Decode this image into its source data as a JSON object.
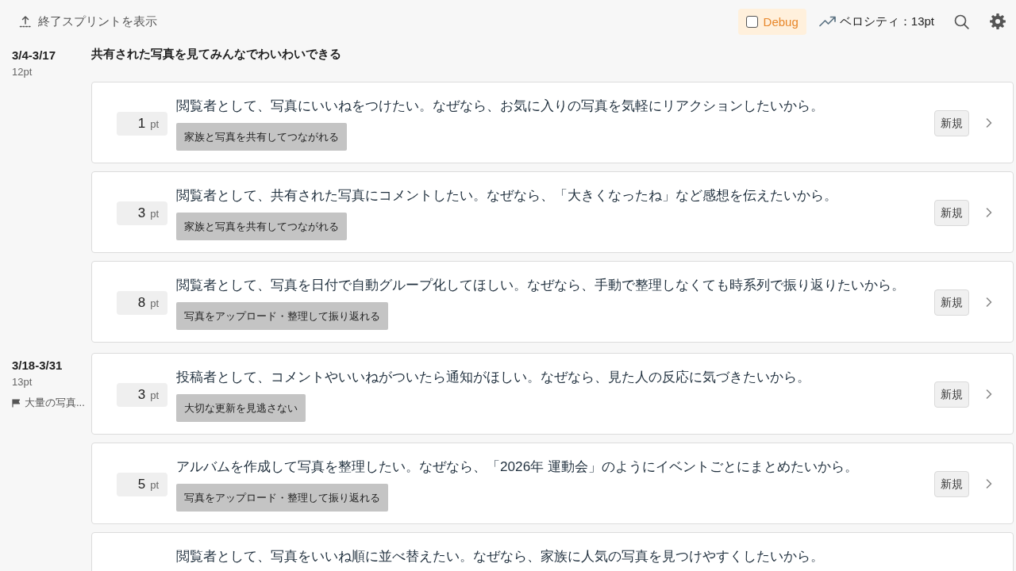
{
  "toolbar": {
    "show_finished": "終了スプリントを表示",
    "debug": {
      "label": "Debug",
      "checked": false
    },
    "velocity": "ベロシティ：13pt"
  },
  "sprints": [
    {
      "dates": "3/4-3/17",
      "points": "12pt",
      "goal": "共有された写真を見てみんなでわいわいできる",
      "stories": [
        {
          "points": "1",
          "unit": "pt",
          "title": "閲覧者として、写真にいいねをつけたい。なぜなら、お気に入りの写真を気軽にリアクションしたいから。",
          "tag": "家族と写真を共有してつながれる",
          "status": "新規"
        },
        {
          "points": "3",
          "unit": "pt",
          "title": "閲覧者として、共有された写真にコメントしたい。なぜなら、「大きくなったね」など感想を伝えたいから。",
          "tag": "家族と写真を共有してつながれる",
          "status": "新規"
        },
        {
          "points": "8",
          "unit": "pt",
          "title": "閲覧者として、写真を日付で自動グループ化してほしい。なぜなら、手動で整理しなくても時系列で振り返りたいから。",
          "tag": "写真をアップロード・整理して振り返れる",
          "status": "新規"
        }
      ]
    },
    {
      "dates": "3/18-3/31",
      "points": "13pt",
      "flag_goal": "大量の写真...",
      "stories": [
        {
          "points": "3",
          "unit": "pt",
          "title": "投稿者として、コメントやいいねがついたら通知がほしい。なぜなら、見た人の反応に気づきたいから。",
          "tag": "大切な更新を見逃さない",
          "status": "新規"
        },
        {
          "points": "5",
          "unit": "pt",
          "title": "アルバムを作成して写真を整理したい。なぜなら、「2026年 運動会」のようにイベントごとにまとめたいから。",
          "tag": "写真をアップロード・整理して振り返れる",
          "status": "新規"
        },
        {
          "title": "閲覧者として、写真をいいね順に並べ替えたい。なぜなら、家族に人気の写真を見つけやすくしたいから。"
        }
      ]
    }
  ]
}
